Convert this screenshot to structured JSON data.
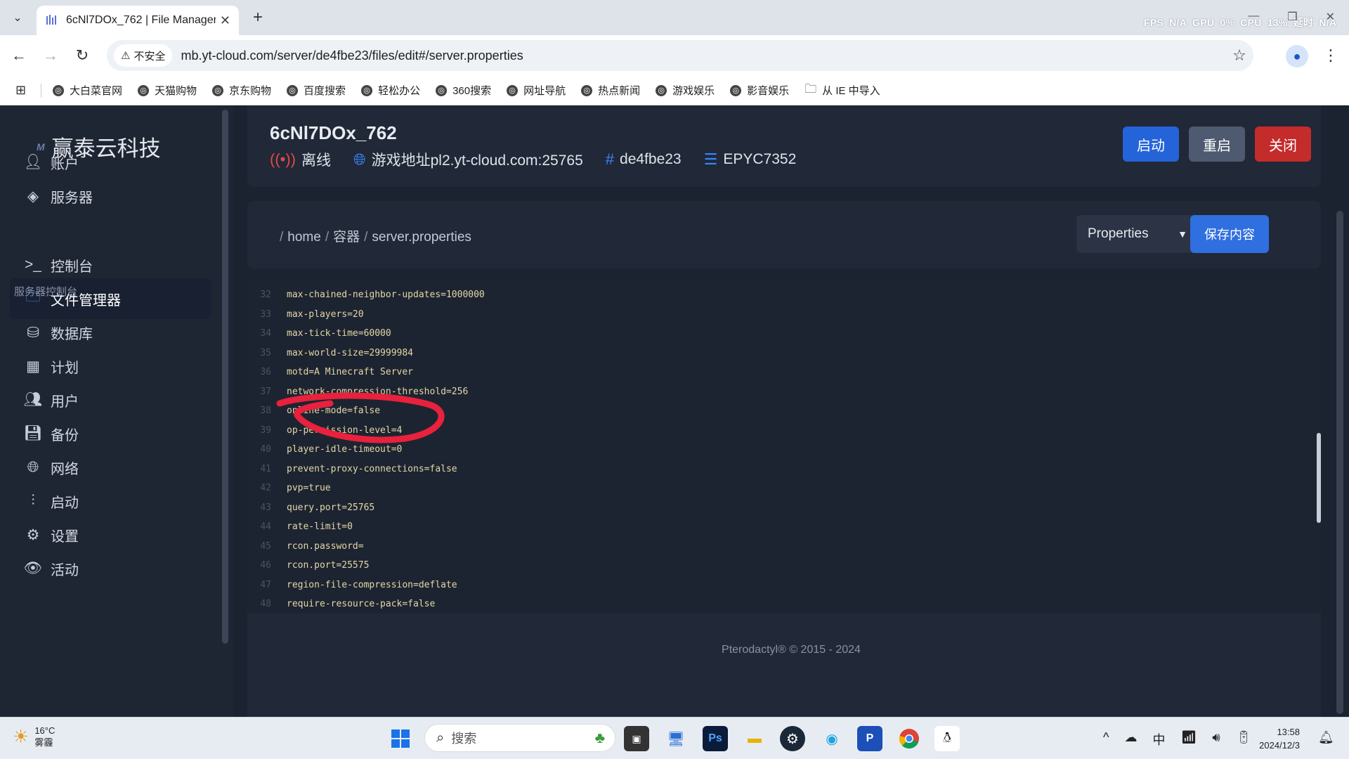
{
  "browser": {
    "tab_title": "6cNl7DOx_762 | File Manager",
    "new_tab": "+",
    "stats": [
      "FPS",
      "N/A",
      "GPU",
      "0%",
      "CPU",
      "13%",
      "延时",
      "N/A"
    ],
    "security_label": "不安全",
    "url": "mb.yt-cloud.com/server/de4fbe23/files/edit#/server.properties",
    "bookmarks": [
      {
        "label": "大白菜官网",
        "icon": "globe-icon"
      },
      {
        "label": "天猫购物",
        "icon": "globe-icon"
      },
      {
        "label": "京东购物",
        "icon": "globe-icon"
      },
      {
        "label": "百度搜索",
        "icon": "globe-icon"
      },
      {
        "label": "轻松办公",
        "icon": "globe-icon"
      },
      {
        "label": "360搜索",
        "icon": "globe-icon"
      },
      {
        "label": "网址导航",
        "icon": "globe-icon"
      },
      {
        "label": "热点新闻",
        "icon": "globe-icon"
      },
      {
        "label": "游戏娱乐",
        "icon": "globe-icon"
      },
      {
        "label": "影音娱乐",
        "icon": "globe-icon"
      },
      {
        "label": "从 IE 中导入",
        "icon": "folder-icon"
      }
    ]
  },
  "sidebar": {
    "brand": "赢泰云科技",
    "brand_logo": "M",
    "section_title": "服务器控制台",
    "items": [
      {
        "label": "账户",
        "icon": "user-icon",
        "active": false
      },
      {
        "label": "服务器",
        "icon": "layers-icon",
        "active": false
      },
      {
        "label": "控制台",
        "icon": "terminal-icon",
        "active": false
      },
      {
        "label": "文件管理器",
        "icon": "folder-icon",
        "active": true
      },
      {
        "label": "数据库",
        "icon": "database-icon",
        "active": false
      },
      {
        "label": "计划",
        "icon": "calendar-icon",
        "active": false
      },
      {
        "label": "用户",
        "icon": "users-icon",
        "active": false
      },
      {
        "label": "备份",
        "icon": "save-icon",
        "active": false
      },
      {
        "label": "网络",
        "icon": "globe-icon",
        "active": false
      },
      {
        "label": "启动",
        "icon": "sliders-icon",
        "active": false
      },
      {
        "label": "设置",
        "icon": "gear-icon",
        "active": false
      },
      {
        "label": "活动",
        "icon": "eye-icon",
        "active": false
      }
    ]
  },
  "server": {
    "name": "6cNl7DOx_762",
    "status": "离线",
    "address": "游戏地址pl2.yt-cloud.com:25765",
    "id": "de4fbe23",
    "node": "EPYC7352",
    "buttons": {
      "start": "启动",
      "restart": "重启",
      "stop": "关闭"
    }
  },
  "file": {
    "breadcrumb": [
      "home",
      "容器",
      "server.properties"
    ],
    "language": "Properties",
    "save_label": "保存内容"
  },
  "editor": {
    "lines": [
      {
        "no": "32",
        "text": "max-chained-neighbor-updates=1000000"
      },
      {
        "no": "33",
        "text": "max-players=20"
      },
      {
        "no": "34",
        "text": "max-tick-time=60000"
      },
      {
        "no": "35",
        "text": "max-world-size=29999984"
      },
      {
        "no": "36",
        "text": "motd=A Minecraft Server"
      },
      {
        "no": "37",
        "text": "network-compression-threshold=256"
      },
      {
        "no": "38",
        "text": "online-mode=false"
      },
      {
        "no": "39",
        "text": "op-permission-level=4"
      },
      {
        "no": "40",
        "text": "player-idle-timeout=0"
      },
      {
        "no": "41",
        "text": "prevent-proxy-connections=false"
      },
      {
        "no": "42",
        "text": "pvp=true"
      },
      {
        "no": "43",
        "text": "query.port=25765"
      },
      {
        "no": "44",
        "text": "rate-limit=0"
      },
      {
        "no": "45",
        "text": "rcon.password="
      },
      {
        "no": "46",
        "text": "rcon.port=25575"
      },
      {
        "no": "47",
        "text": "region-file-compression=deflate"
      },
      {
        "no": "48",
        "text": "require-resource-pack=false"
      }
    ]
  },
  "footer": "Pterodactyl® © 2015 - 2024",
  "taskbar": {
    "weather_temp": "16°C",
    "weather_desc": "雾霾",
    "search_placeholder": "搜索",
    "tray": [
      "^",
      "☁",
      "中",
      "wifi",
      "volume",
      "battery"
    ],
    "time": "13:58",
    "date": "2024/12/3"
  },
  "colors": {
    "start": "#2563d9",
    "restart": "#4d5a70",
    "stop": "#c42b2b",
    "accent": "#3a86ff",
    "annotation": "#e8213c"
  }
}
